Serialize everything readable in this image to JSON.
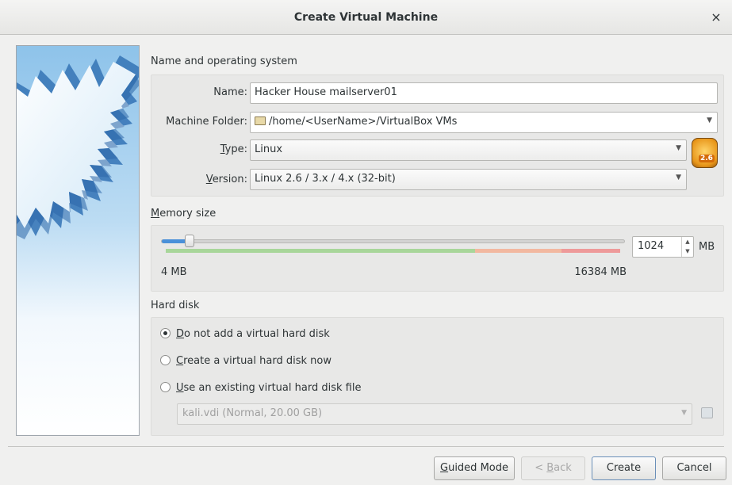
{
  "window": {
    "title": "Create Virtual Machine",
    "close_glyph": "×"
  },
  "name_os": {
    "section_title": "Name and operating system",
    "name_label": "Name:",
    "name_value": "Hacker House mailserver01",
    "folder_label": "Machine Folder:",
    "folder_value": "/home/<UserName>/VirtualBox VMs",
    "type_label_mnemonic": "T",
    "type_label_rest": "ype:",
    "type_value": "Linux",
    "version_label_mnemonic": "V",
    "version_label_rest": "ersion:",
    "version_value": "Linux 2.6 / 3.x / 4.x (32-bit)",
    "os_badge_text": "2.6"
  },
  "memory": {
    "section_title_mnemonic": "M",
    "section_title_rest": "emory size",
    "min_label": "4 MB",
    "max_label": "16384 MB",
    "value": "1024",
    "unit": "MB",
    "min_mb": 4,
    "max_mb": 16384,
    "current_mb": 1024,
    "colors": {
      "fill": "#4a90d9",
      "safe": "#a8d69a",
      "warn": "#f2b8a0",
      "danger": "#ee9a9a"
    }
  },
  "hard_disk": {
    "section_title": "Hard disk",
    "options": [
      {
        "mnemonic": "D",
        "rest": "o not add a virtual hard disk",
        "checked": true
      },
      {
        "mnemonic": "C",
        "rest": "reate a virtual hard disk now",
        "checked": false
      },
      {
        "mnemonic": "U",
        "rest": "se an existing virtual hard disk file",
        "checked": false
      }
    ],
    "existing_file": "kali.vdi (Normal, 20.00 GB)"
  },
  "buttons": {
    "guided_mnemonic": "G",
    "guided_rest": "uided Mode",
    "back_prefix": "< ",
    "back_mnemonic": "B",
    "back_rest": "ack",
    "create": "Create",
    "cancel": "Cancel"
  }
}
